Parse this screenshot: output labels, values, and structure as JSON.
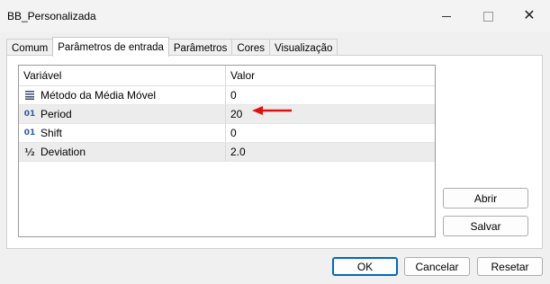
{
  "window": {
    "title": "BB_Personalizada",
    "minimize_icon": "minimize-icon",
    "maximize_icon": "maximize-icon",
    "close_icon": "close-icon"
  },
  "tabs": [
    {
      "label": "Comum",
      "active": false
    },
    {
      "label": "Parâmetros de entrada",
      "active": true
    },
    {
      "label": "Parâmetros",
      "active": false
    },
    {
      "label": "Cores",
      "active": false
    },
    {
      "label": "Visualização",
      "active": false
    }
  ],
  "grid": {
    "columns": [
      "Variável",
      "Valor"
    ],
    "rows": [
      {
        "icon": "enum-list-icon",
        "name": "Método da Média Móvel",
        "value": "0"
      },
      {
        "icon": "integer-01-icon",
        "name": "Period",
        "value": "20"
      },
      {
        "icon": "integer-01-icon",
        "name": "Shift",
        "value": "0"
      },
      {
        "icon": "fraction-half-icon",
        "name": "Deviation",
        "value": "2.0"
      }
    ],
    "annotation_color": "#e01010"
  },
  "side_buttons": {
    "open": "Abrir",
    "save": "Salvar"
  },
  "footer": {
    "ok": "OK",
    "cancel": "Cancelar",
    "reset": "Resetar"
  },
  "accent_color": "#0067c0"
}
